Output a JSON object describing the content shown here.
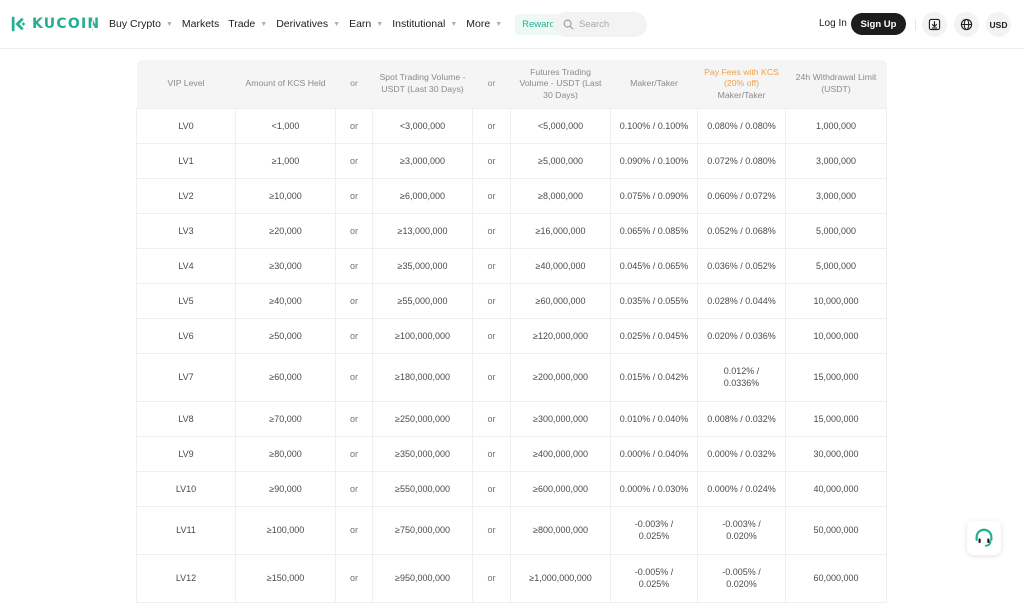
{
  "header": {
    "logo_text": "KUCOIN",
    "brand_color": "#23af91",
    "nav": [
      {
        "label": "Buy Crypto",
        "has_dropdown": true
      },
      {
        "label": "Markets",
        "has_dropdown": false
      },
      {
        "label": "Trade",
        "has_dropdown": true
      },
      {
        "label": "Derivatives",
        "has_dropdown": true
      },
      {
        "label": "Earn",
        "has_dropdown": true
      },
      {
        "label": "Institutional",
        "has_dropdown": true
      },
      {
        "label": "More",
        "has_dropdown": true
      }
    ],
    "rewards_hub": "Rewards Hub",
    "search_placeholder": "Search",
    "login": "Log In",
    "signup": "Sign Up",
    "download_icon": "download-icon",
    "globe_icon": "globe-icon",
    "currency": "USD"
  },
  "table": {
    "headers": {
      "vip_level": "VIP Level",
      "kcs_held": "Amount of KCS Held",
      "or1": "or",
      "spot_volume": "Spot Trading Volume - USDT (Last 30 Days)",
      "or2": "or",
      "futures_volume": "Futures Trading Volume - USDT (Last 30 Days)",
      "maker_taker": "Maker/Taker",
      "kcs_fee_highlight": "Pay Fees with KCS (20% off)",
      "kcs_fee_sub": "Maker/Taker",
      "withdrawal": "24h Withdrawal Limit (USDT)"
    },
    "highlight_color": "#f0a04b",
    "rows": [
      {
        "level": "LV0",
        "kcs": "<1,000",
        "or1": "or",
        "spot": "<3,000,000",
        "or2": "or",
        "futures": "<5,000,000",
        "fee": "0.100% / 0.100%",
        "kcs_fee": "0.080% / 0.080%",
        "withdrawal": "1,000,000"
      },
      {
        "level": "LV1",
        "kcs": "≥1,000",
        "or1": "or",
        "spot": "≥3,000,000",
        "or2": "or",
        "futures": "≥5,000,000",
        "fee": "0.090% / 0.100%",
        "kcs_fee": "0.072% / 0.080%",
        "withdrawal": "3,000,000"
      },
      {
        "level": "LV2",
        "kcs": "≥10,000",
        "or1": "or",
        "spot": "≥6,000,000",
        "or2": "or",
        "futures": "≥8,000,000",
        "fee": "0.075% / 0.090%",
        "kcs_fee": "0.060% / 0.072%",
        "withdrawal": "3,000,000"
      },
      {
        "level": "LV3",
        "kcs": "≥20,000",
        "or1": "or",
        "spot": "≥13,000,000",
        "or2": "or",
        "futures": "≥16,000,000",
        "fee": "0.065% / 0.085%",
        "kcs_fee": "0.052% / 0.068%",
        "withdrawal": "5,000,000"
      },
      {
        "level": "LV4",
        "kcs": "≥30,000",
        "or1": "or",
        "spot": "≥35,000,000",
        "or2": "or",
        "futures": "≥40,000,000",
        "fee": "0.045% / 0.065%",
        "kcs_fee": "0.036% / 0.052%",
        "withdrawal": "5,000,000"
      },
      {
        "level": "LV5",
        "kcs": "≥40,000",
        "or1": "or",
        "spot": "≥55,000,000",
        "or2": "or",
        "futures": "≥60,000,000",
        "fee": "0.035% / 0.055%",
        "kcs_fee": "0.028% / 0.044%",
        "withdrawal": "10,000,000"
      },
      {
        "level": "LV6",
        "kcs": "≥50,000",
        "or1": "or",
        "spot": "≥100,000,000",
        "or2": "or",
        "futures": "≥120,000,000",
        "fee": "0.025% / 0.045%",
        "kcs_fee": "0.020% / 0.036%",
        "withdrawal": "10,000,000"
      },
      {
        "level": "LV7",
        "kcs": "≥60,000",
        "or1": "or",
        "spot": "≥180,000,000",
        "or2": "or",
        "futures": "≥200,000,000",
        "fee": "0.015% / 0.042%",
        "kcs_fee": "0.012% / 0.0336%",
        "withdrawal": "15,000,000",
        "tall": true
      },
      {
        "level": "LV8",
        "kcs": "≥70,000",
        "or1": "or",
        "spot": "≥250,000,000",
        "or2": "or",
        "futures": "≥300,000,000",
        "fee": "0.010% / 0.040%",
        "kcs_fee": "0.008% / 0.032%",
        "withdrawal": "15,000,000"
      },
      {
        "level": "LV9",
        "kcs": "≥80,000",
        "or1": "or",
        "spot": "≥350,000,000",
        "or2": "or",
        "futures": "≥400,000,000",
        "fee": "0.000% / 0.040%",
        "kcs_fee": "0.000% / 0.032%",
        "withdrawal": "30,000,000"
      },
      {
        "level": "LV10",
        "kcs": "≥90,000",
        "or1": "or",
        "spot": "≥550,000,000",
        "or2": "or",
        "futures": "≥600,000,000",
        "fee": "0.000% / 0.030%",
        "kcs_fee": "0.000% / 0.024%",
        "withdrawal": "40,000,000"
      },
      {
        "level": "LV11",
        "kcs": "≥100,000",
        "or1": "or",
        "spot": "≥750,000,000",
        "or2": "or",
        "futures": "≥800,000,000",
        "fee": "-0.003% / 0.025%",
        "kcs_fee": "-0.003% / 0.020%",
        "withdrawal": "50,000,000",
        "tall": true
      },
      {
        "level": "LV12",
        "kcs": "≥150,000",
        "or1": "or",
        "spot": "≥950,000,000",
        "or2": "or",
        "futures": "≥1,000,000,000",
        "fee": "-0.005% / 0.025%",
        "kcs_fee": "-0.005% / 0.020%",
        "withdrawal": "60,000,000",
        "tall": true
      }
    ]
  },
  "support_icon": "headset-icon"
}
